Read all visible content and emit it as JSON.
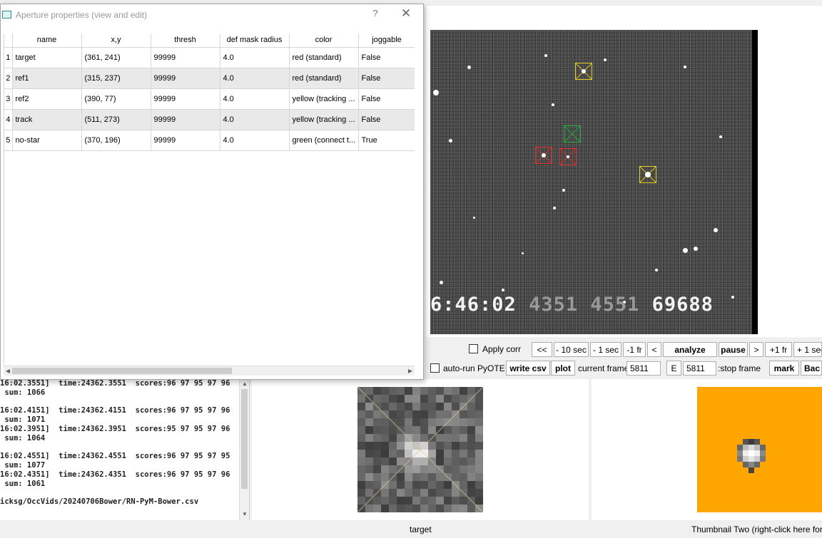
{
  "dialog": {
    "title": "Aperture properties (view and edit)",
    "help_glyph": "?",
    "close_glyph": "✕",
    "columns": [
      "name",
      "x,y",
      "thresh",
      "def mask radius",
      "color",
      "joggable"
    ],
    "rows": [
      {
        "num": "1",
        "name": "target",
        "xy": "(361, 241)",
        "thresh": "99999",
        "radius": "4.0",
        "color": "red (standard)",
        "joggable": "False"
      },
      {
        "num": "2",
        "name": "ref1",
        "xy": "(315, 237)",
        "thresh": "99999",
        "radius": "4.0",
        "color": "red (standard)",
        "joggable": "False"
      },
      {
        "num": "3",
        "name": "ref2",
        "xy": "(390, 77)",
        "thresh": "99999",
        "radius": "4.0",
        "color": "yellow (tracking ...",
        "joggable": "False"
      },
      {
        "num": "4",
        "name": "track",
        "xy": "(511, 273)",
        "thresh": "99999",
        "radius": "4.0",
        "color": "yellow (tracking ...",
        "joggable": "False"
      },
      {
        "num": "5",
        "name": "no-star",
        "xy": "(370, 196)",
        "thresh": "99999",
        "radius": "4.0",
        "color": "green (connect t...",
        "joggable": "True"
      }
    ]
  },
  "video": {
    "timestamp_time": "6:46:02",
    "timestamp_field1": "4351",
    "timestamp_field2": "4551",
    "timestamp_count": "69688",
    "aperture_colors": {
      "red": "#e0302a",
      "yellow": "#e6d229",
      "green": "#22b33a"
    }
  },
  "controls": {
    "apply_corr": "Apply corr",
    "auto_run": "auto-run PyOTE",
    "btn_back_all": "<<",
    "btn_minus10": "- 10 sec",
    "btn_minus1sec": "- 1 sec",
    "btn_minus1fr": "-1 fr",
    "btn_back": "<",
    "btn_analyze": "analyze",
    "btn_pause": "pause",
    "btn_fwd": ">",
    "btn_plus1fr": "+1 fr",
    "btn_plus1sec": "+ 1 sec",
    "btn_write_csv": "write csv",
    "btn_plot": "plot",
    "current_frame_label": "current frame:",
    "current_frame_value": "5811",
    "btn_e": "E",
    "stop_frame_value": "5811",
    "stop_frame_label": ":stop frame",
    "btn_mark": "mark",
    "btn_back_cut": "Bac"
  },
  "log": {
    "text": "16:02.3551]  time:24362.3551  scores:96 97 95 97 96\n sum: 1066\n\n16:02.4151]  time:24362.4151  scores:96 97 95 97 96\n sum: 1071\n16:02.3951]  time:24362.3951  scores:95 97 95 97 96\n sum: 1064\n\n16:02.4551]  time:24362.4551  scores:96 97 95 97 95\n sum: 1077\n16:02.4351]  time:24362.4351  scores:96 97 95 97 96\n sum: 1061\n\nicksg/OccVids/20240706Bower/RN-PyM-Bower.csv"
  },
  "status": {
    "thumb1_label": "target",
    "thumb2_label": "Thumbnail Two (right-click here for info"
  },
  "colors": {
    "thumb2_bg": "#ffa500"
  }
}
